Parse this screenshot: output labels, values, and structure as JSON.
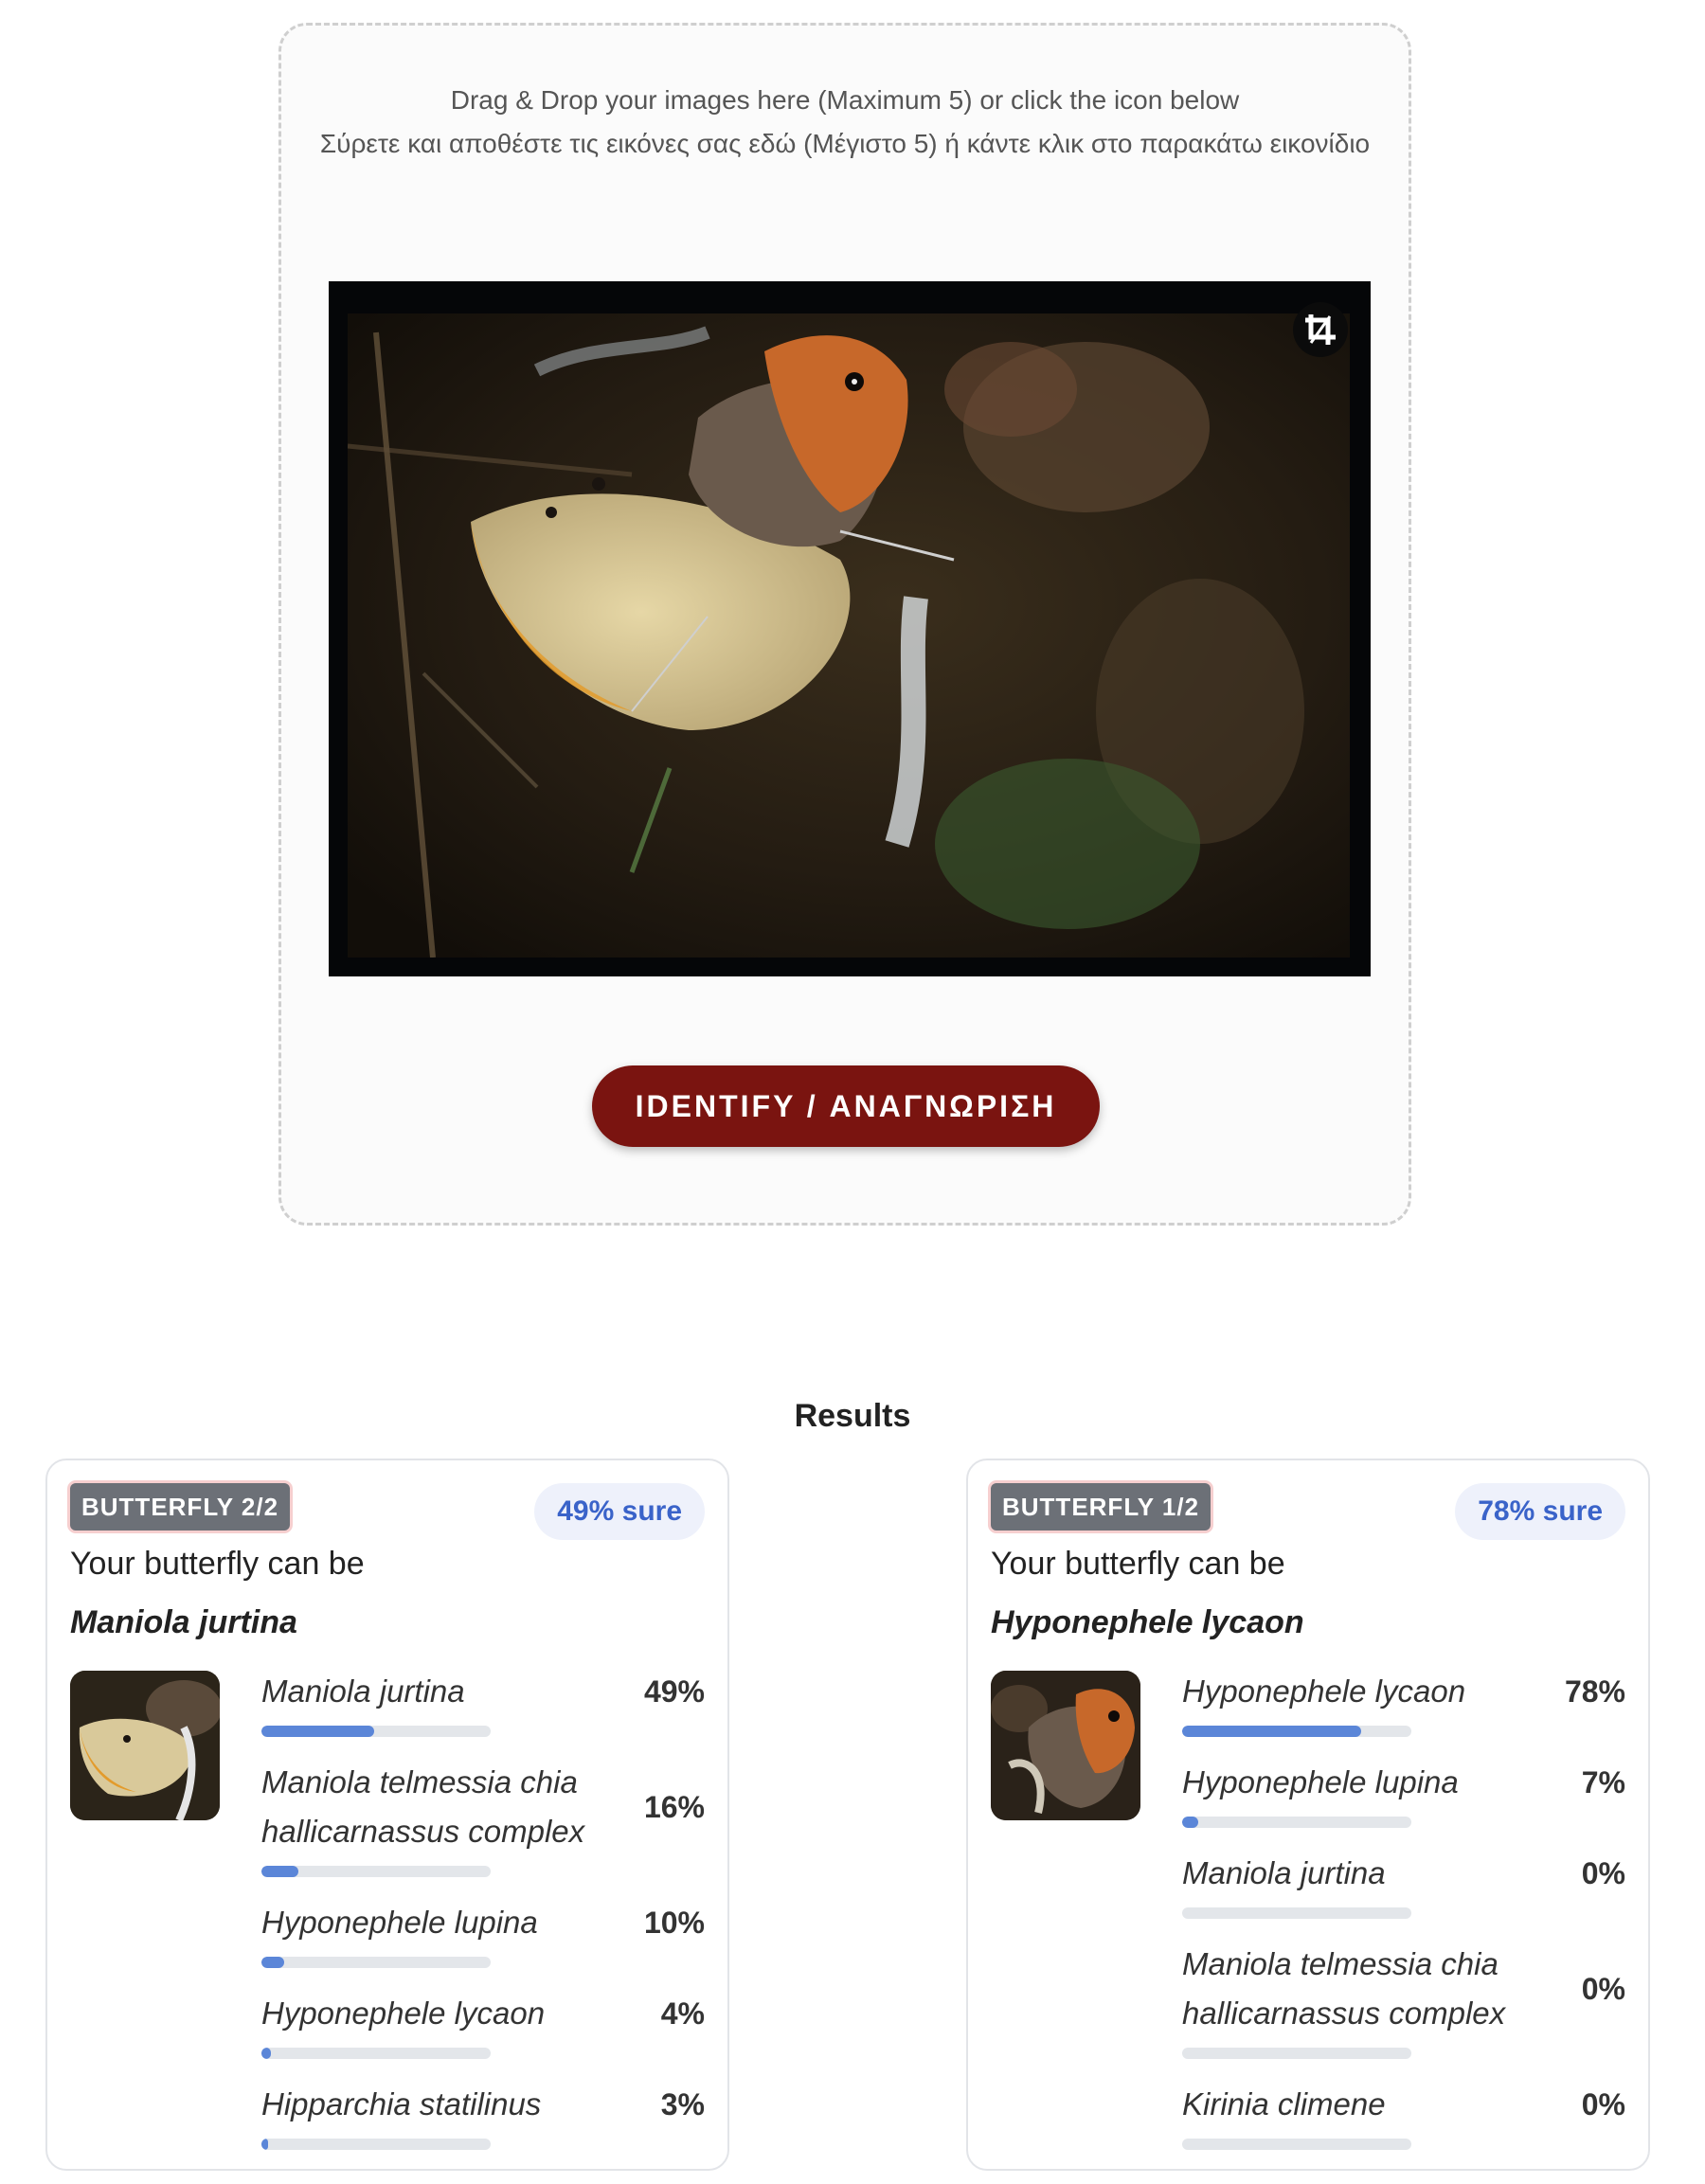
{
  "upload": {
    "instruction_en": "Drag & Drop your images here (Maximum 5) or click the icon below",
    "instruction_el": "Σύρετε και αποθέστε τις εικόνες σας εδώ (Μέγιστο 5) ή κάντε κλικ στο παρακάτω εικονίδιο",
    "crop_icon": "crop-icon",
    "identify_label": "IDENTIFY / ΑΝΑΓΝΩΡΙΣΗ"
  },
  "results": {
    "title": "Results",
    "cards": [
      {
        "badge": "BUTTERFLY 2/2",
        "confidence": "49% sure",
        "lead": "Your butterfly can be",
        "species": "Maniola jurtina",
        "predictions": [
          {
            "name": "Maniola jurtina",
            "pct": "49%",
            "value": 49
          },
          {
            "name": "Maniola telmessia chia hallicarnassus complex",
            "pct": "16%",
            "value": 16
          },
          {
            "name": "Hyponephele lupina",
            "pct": "10%",
            "value": 10
          },
          {
            "name": "Hyponephele lycaon",
            "pct": "4%",
            "value": 4
          },
          {
            "name": "Hipparchia statilinus",
            "pct": "3%",
            "value": 3
          }
        ]
      },
      {
        "badge": "BUTTERFLY 1/2",
        "confidence": "78% sure",
        "lead": "Your butterfly can be",
        "species": "Hyponephele lycaon",
        "predictions": [
          {
            "name": "Hyponephele lycaon",
            "pct": "78%",
            "value": 78
          },
          {
            "name": "Hyponephele lupina",
            "pct": "7%",
            "value": 7
          },
          {
            "name": "Maniola jurtina",
            "pct": "0%",
            "value": 0
          },
          {
            "name": "Maniola telmessia chia hallicarnassus complex",
            "pct": "0%",
            "value": 0
          },
          {
            "name": "Kirinia climene",
            "pct": "0%",
            "value": 0
          }
        ]
      }
    ]
  },
  "colors": {
    "identify_button": "#7a1410",
    "bar_fill": "#5b86d8",
    "sure_text": "#3a63c9",
    "badge_bg": "#6c7077"
  }
}
